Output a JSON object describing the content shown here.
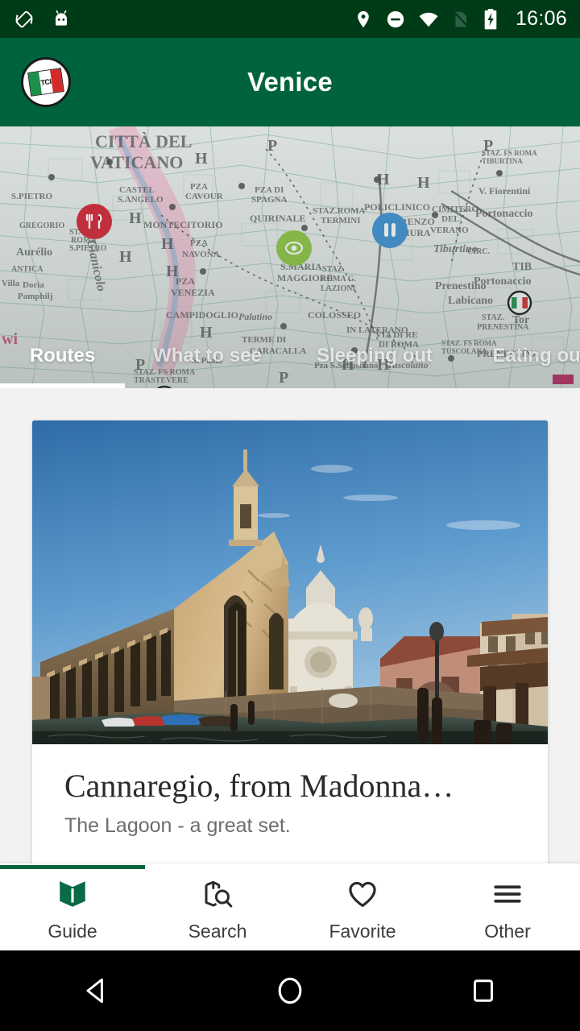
{
  "status_bar": {
    "time": "16:06",
    "left_icons": [
      "screen-rotation-icon",
      "android-debug-icon"
    ],
    "right_icons": [
      "location-icon",
      "do-not-disturb-icon",
      "wifi-icon",
      "no-sim-icon",
      "battery-charging-icon"
    ],
    "background_color": "#003b18"
  },
  "app_bar": {
    "title": "Venice",
    "logo_name": "tci-logo",
    "logo_text": "TCI",
    "background_color": "#00633e"
  },
  "map_header": {
    "name": "rome-map-banner",
    "markers": [
      {
        "type": "eating-marker",
        "color": "#d32030",
        "icon": "cutlery-icon"
      },
      {
        "type": "sightseeing-marker",
        "color": "#8cc63e",
        "icon": "eye-icon"
      },
      {
        "type": "sleeping-marker",
        "color": "#3a8fd4",
        "icon": "bed-icon"
      },
      {
        "type": "tci-marker",
        "color": "#ffffff",
        "icon": "italy-flag-icon"
      },
      {
        "type": "tci-marker",
        "color": "#ffffff",
        "icon": "italy-flag-icon"
      }
    ],
    "map_labels": [
      "CITTA DEL VATICANO",
      "S.PIETRO",
      "CASTEL S.ANGELO",
      "PZA CAVOUR",
      "MONTECITORIO",
      "PZA NAVONA",
      "PZA DI SPAGNA",
      "QUIRINALE",
      "S.MARIA MAGGIORE",
      "TERMINI",
      "POLICLINICO",
      "S.LORENZO F. LE MURA",
      "CIMITERO DEL VERANO",
      "Portonaccio",
      "V. Fiorentini",
      "CAMPIDOGLIO",
      "PZA VENEZIA",
      "COLOSSEO",
      "Palatino",
      "Tuscolano",
      "Aurelio",
      "Villa Doria Pamphilj",
      "Tor",
      "Prenestino Labicano",
      "TERME DI CARACALLA",
      "IN LATERANO",
      "STAZ. FS ROMA TIBURTINA",
      "STAZ. ROMA S.PIETRO",
      "P"
    ],
    "tabs": [
      {
        "label": "Routes",
        "active": true
      },
      {
        "label": "What to see",
        "active": false
      },
      {
        "label": "Sleeping out",
        "active": false
      },
      {
        "label": "Eating out",
        "active": false
      }
    ]
  },
  "content": {
    "card": {
      "name": "route-card",
      "image_alt": "madonna-dellorto-church-venice",
      "title": "Cannaregio, from Madonna…",
      "subtitle": "The Lagoon - a great set."
    }
  },
  "bottom_nav": {
    "progress_color": "#00633e",
    "items": [
      {
        "label": "Guide",
        "icon": "book-icon",
        "active": true
      },
      {
        "label": "Search",
        "icon": "map-search-icon",
        "active": false
      },
      {
        "label": "Favorite",
        "icon": "heart-icon",
        "active": false
      },
      {
        "label": "Other",
        "icon": "hamburger-menu-icon",
        "active": false
      }
    ]
  },
  "android_nav": {
    "buttons": [
      {
        "name": "back-button",
        "icon": "triangle-back-icon"
      },
      {
        "name": "home-button",
        "icon": "circle-home-icon"
      },
      {
        "name": "recents-button",
        "icon": "square-recents-icon"
      }
    ]
  }
}
